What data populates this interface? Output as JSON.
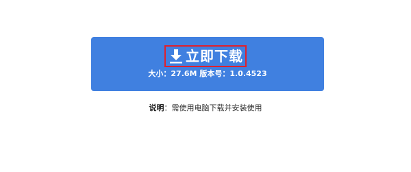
{
  "download_button": {
    "label": "立即下载",
    "icon": "download-icon",
    "size_label": "大小：",
    "size_value": "27.6M",
    "version_label": "版本号：",
    "version_value": "1.0.4523"
  },
  "note": {
    "label": "说明",
    "separator": "：",
    "text": "需使用电脑下载并安装使用"
  },
  "colors": {
    "button_bg": "#4080e0",
    "highlight_border": "#e0202c",
    "text_dark": "#333333"
  }
}
